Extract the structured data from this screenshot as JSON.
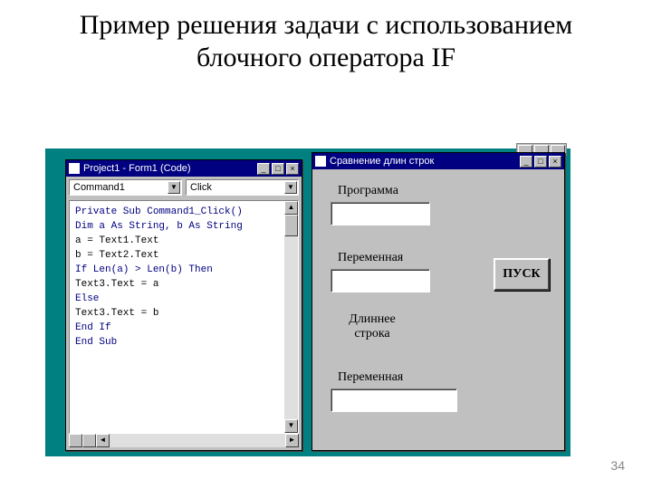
{
  "slide": {
    "title": "Пример решения задачи с использованием блочного оператора IF",
    "page_number": "34"
  },
  "code_window": {
    "title": "Project1 - Form1 (Code)",
    "combo_object": "Command1",
    "combo_proc": "Click",
    "lines": [
      "Private Sub Command1_Click()",
      "Dim a As String, b As String",
      "a = Text1.Text",
      "b = Text2.Text",
      "If Len(a) > Len(b) Then",
      "Text3.Text = a",
      "Else",
      "Text3.Text = b",
      "End If",
      "End Sub"
    ]
  },
  "form_window": {
    "title": "Сравнение длин строк",
    "labels": {
      "l1": "Программа",
      "l2": "Переменная",
      "l3": "Длиннее строка",
      "l4": "Переменная"
    },
    "button": "ПУСК"
  },
  "glyphs": {
    "min": "_",
    "max": "□",
    "close": "×",
    "down": "▼",
    "up": "▲",
    "left": "◄",
    "right": "►"
  }
}
